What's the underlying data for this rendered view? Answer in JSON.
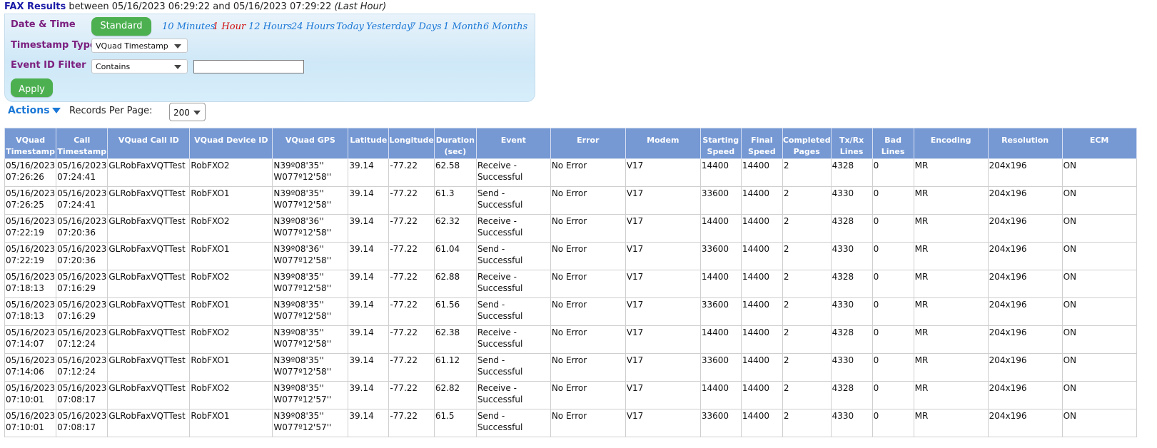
{
  "header": {
    "title_strong": "FAX Results",
    "title_middle": "between 05/16/2023 06:29:22 and 05/16/2023 07:29:22",
    "title_range": "(Last Hour)"
  },
  "filters": {
    "date_time_label": "Date & Time",
    "standard_button": "Standard",
    "quick_ranges": [
      "10 Minutes",
      "1 Hour",
      "12 Hours",
      "24 Hours",
      "Today",
      "Yesterday",
      "7 Days",
      "1 Month",
      "6 Months"
    ],
    "active_range": "1 Hour",
    "timestamp_type_label": "Timestamp Type",
    "timestamp_type_value": "VQuad Timestamp",
    "event_id_filter_label": "Event ID Filter",
    "event_id_filter_mode": "Contains",
    "event_id_filter_value": "",
    "apply_button": "Apply"
  },
  "toolbar": {
    "actions_label": "Actions",
    "records_per_page_label": "Records Per Page:",
    "records_per_page_value": "200"
  },
  "colors": {
    "header_bg": "#7699d4",
    "apply_green": "#4cb050",
    "link_blue": "#1b78d6",
    "active_red": "#d01010",
    "label_purple": "#7b1f7f"
  },
  "table": {
    "columns": [
      "VQuad Timestamp",
      "Call Timestamp",
      "VQuad Call ID",
      "VQuad Device ID",
      "VQuad GPS",
      "Latitude",
      "Longitude",
      "Duration (sec)",
      "Event",
      "Error",
      "Modem",
      "Starting Speed",
      "Final Speed",
      "Completed Pages",
      "Tx/Rx Lines",
      "Bad Lines",
      "Encoding",
      "Resolution",
      "ECM"
    ],
    "rows": [
      [
        "05/16/2023 07:26:26",
        "05/16/2023 07:24:41",
        "GLRobFaxVQTTest",
        "RobFXO2",
        "N39º08'35'' W077º12'58''",
        "39.14",
        "-77.22",
        "62.58",
        "Receive - Successful",
        "No Error",
        "V17",
        "14400",
        "14400",
        "2",
        "4328",
        "0",
        "MR",
        "204x196",
        "ON"
      ],
      [
        "05/16/2023 07:26:25",
        "05/16/2023 07:24:41",
        "GLRobFaxVQTTest",
        "RobFXO1",
        "N39º08'35'' W077º12'58''",
        "39.14",
        "-77.22",
        "61.3",
        "Send - Successful",
        "No Error",
        "V17",
        "33600",
        "14400",
        "2",
        "4330",
        "0",
        "MR",
        "204x196",
        "ON"
      ],
      [
        "05/16/2023 07:22:19",
        "05/16/2023 07:20:36",
        "GLRobFaxVQTTest",
        "RobFXO2",
        "N39º08'36'' W077º12'58''",
        "39.14",
        "-77.22",
        "62.32",
        "Receive - Successful",
        "No Error",
        "V17",
        "14400",
        "14400",
        "2",
        "4328",
        "0",
        "MR",
        "204x196",
        "ON"
      ],
      [
        "05/16/2023 07:22:19",
        "05/16/2023 07:20:36",
        "GLRobFaxVQTTest",
        "RobFXO1",
        "N39º08'36'' W077º12'58''",
        "39.14",
        "-77.22",
        "61.04",
        "Send - Successful",
        "No Error",
        "V17",
        "33600",
        "14400",
        "2",
        "4330",
        "0",
        "MR",
        "204x196",
        "ON"
      ],
      [
        "05/16/2023 07:18:13",
        "05/16/2023 07:16:29",
        "GLRobFaxVQTTest",
        "RobFXO2",
        "N39º08'35'' W077º12'58''",
        "39.14",
        "-77.22",
        "62.88",
        "Receive - Successful",
        "No Error",
        "V17",
        "14400",
        "14400",
        "2",
        "4328",
        "0",
        "MR",
        "204x196",
        "ON"
      ],
      [
        "05/16/2023 07:18:13",
        "05/16/2023 07:16:29",
        "GLRobFaxVQTTest",
        "RobFXO1",
        "N39º08'35'' W077º12'58''",
        "39.14",
        "-77.22",
        "61.56",
        "Send - Successful",
        "No Error",
        "V17",
        "33600",
        "14400",
        "2",
        "4330",
        "0",
        "MR",
        "204x196",
        "ON"
      ],
      [
        "05/16/2023 07:14:07",
        "05/16/2023 07:12:24",
        "GLRobFaxVQTTest",
        "RobFXO2",
        "N39º08'35'' W077º12'58''",
        "39.14",
        "-77.22",
        "62.38",
        "Receive - Successful",
        "No Error",
        "V17",
        "14400",
        "14400",
        "2",
        "4328",
        "0",
        "MR",
        "204x196",
        "ON"
      ],
      [
        "05/16/2023 07:14:06",
        "05/16/2023 07:12:24",
        "GLRobFaxVQTTest",
        "RobFXO1",
        "N39º08'35'' W077º12'58''",
        "39.14",
        "-77.22",
        "61.12",
        "Send - Successful",
        "No Error",
        "V17",
        "33600",
        "14400",
        "2",
        "4330",
        "0",
        "MR",
        "204x196",
        "ON"
      ],
      [
        "05/16/2023 07:10:01",
        "05/16/2023 07:08:17",
        "GLRobFaxVQTTest",
        "RobFXO2",
        "N39º08'35'' W077º12'57''",
        "39.14",
        "-77.22",
        "62.82",
        "Receive - Successful",
        "No Error",
        "V17",
        "14400",
        "14400",
        "2",
        "4328",
        "0",
        "MR",
        "204x196",
        "ON"
      ],
      [
        "05/16/2023 07:10:01",
        "05/16/2023 07:08:17",
        "GLRobFaxVQTTest",
        "RobFXO1",
        "N39º08'35'' W077º12'57''",
        "39.14",
        "-77.22",
        "61.5",
        "Send - Successful",
        "No Error",
        "V17",
        "33600",
        "14400",
        "2",
        "4330",
        "0",
        "MR",
        "204x196",
        "ON"
      ]
    ]
  }
}
